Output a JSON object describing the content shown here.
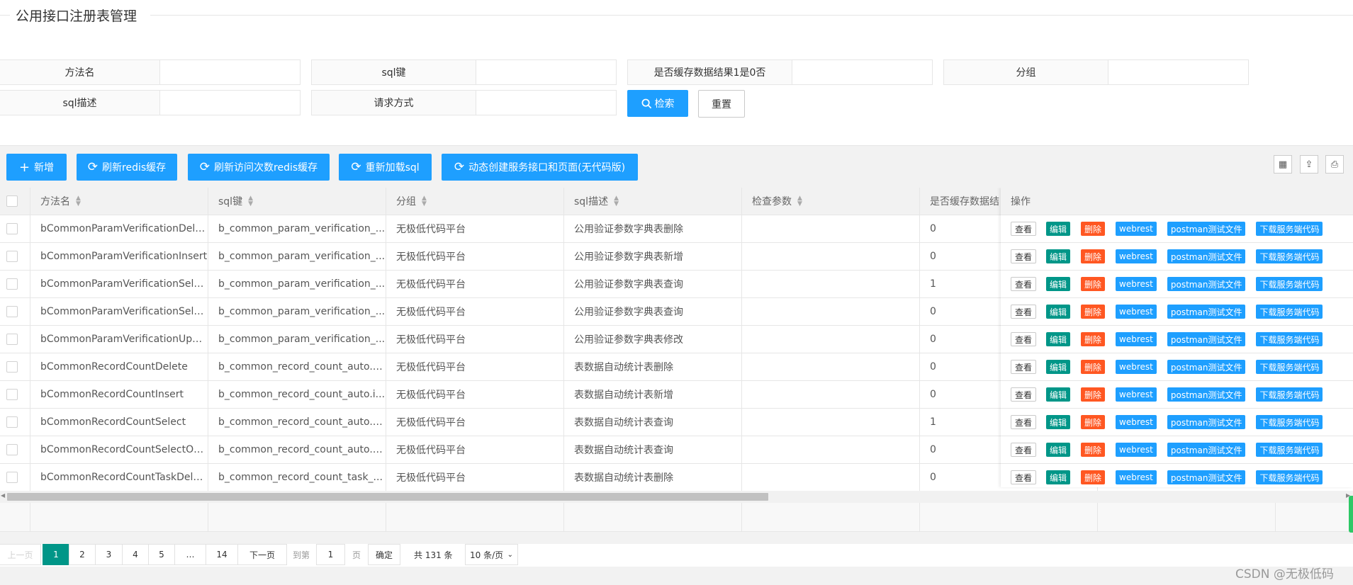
{
  "page_title": "公用接口注册表管理",
  "form": {
    "fields": [
      {
        "label": "方法名",
        "value": "",
        "placeholder": ""
      },
      {
        "label": "sql键",
        "value": "",
        "placeholder": ""
      },
      {
        "label": "是否缓存数据结果1是0否",
        "value": "",
        "placeholder": ""
      },
      {
        "label": "分组",
        "value": "",
        "placeholder": ""
      },
      {
        "label": "sql描述",
        "value": "",
        "placeholder": ""
      },
      {
        "label": "请求方式",
        "value": "",
        "placeholder": ""
      }
    ],
    "search_label": "检索",
    "reset_label": "重置"
  },
  "toolbar": {
    "add": "新增",
    "refresh_redis": "刷新redis缓存",
    "refresh_visits": "刷新访问次数redis缓存",
    "reload_sql": "重新加载sql",
    "dynamic_create": "动态创建服务接口和页面(无代码版)"
  },
  "table": {
    "headers": [
      "方法名",
      "sql键",
      "分组",
      "sql描述",
      "检查参数",
      "是否缓存数据结"
    ],
    "op_header": "操作",
    "op_buttons": {
      "view": "查看",
      "edit": "编辑",
      "delete": "删除",
      "webrest": "webrest",
      "postman": "postman测试文件",
      "download": "下载服务端代码"
    },
    "rows": [
      [
        "bCommonParamVerificationDelete",
        "b_common_param_verification_...",
        "无极低代码平台",
        "公用验证参数字典表删除",
        "",
        "0"
      ],
      [
        "bCommonParamVerificationInsert",
        "b_common_param_verification_...",
        "无极低代码平台",
        "公用验证参数字典表新增",
        "",
        "0"
      ],
      [
        "bCommonParamVerificationSelect",
        "b_common_param_verification_...",
        "无极低代码平台",
        "公用验证参数字典表查询",
        "",
        "1"
      ],
      [
        "bCommonParamVerificationSele...",
        "b_common_param_verification_...",
        "无极低代码平台",
        "公用验证参数字典表查询",
        "",
        "0"
      ],
      [
        "bCommonParamVerificationUpdate",
        "b_common_param_verification_...",
        "无极低代码平台",
        "公用验证参数字典表修改",
        "",
        "0"
      ],
      [
        "bCommonRecordCountDelete",
        "b_common_record_count_auto.d...",
        "无极低代码平台",
        "表数据自动统计表删除",
        "",
        "0"
      ],
      [
        "bCommonRecordCountInsert",
        "b_common_record_count_auto.i...",
        "无极低代码平台",
        "表数据自动统计表新增",
        "",
        "0"
      ],
      [
        "bCommonRecordCountSelect",
        "b_common_record_count_auto.s...",
        "无极低代码平台",
        "表数据自动统计表查询",
        "",
        "1"
      ],
      [
        "bCommonRecordCountSelectOn...",
        "b_common_record_count_auto.s...",
        "无极低代码平台",
        "表数据自动统计表查询",
        "",
        "0"
      ],
      [
        "bCommonRecordCountTaskDelete",
        "b_common_record_count_task_...",
        "无极低代码平台",
        "表数据自动统计表删除",
        "",
        "0"
      ]
    ]
  },
  "pager": {
    "prev": "上一页",
    "pages": [
      "1",
      "2",
      "3",
      "4",
      "5",
      "…",
      "14"
    ],
    "current": "1",
    "next": "下一页",
    "goto_label": "到第",
    "goto_value": "1",
    "page_unit": "页",
    "confirm": "确定",
    "total": "共 131 条",
    "page_size": "10 条/页"
  },
  "watermark": "CSDN @无极低码",
  "colors": {
    "primary": "#1e9fff",
    "success": "#009688",
    "danger": "#ff5722"
  }
}
